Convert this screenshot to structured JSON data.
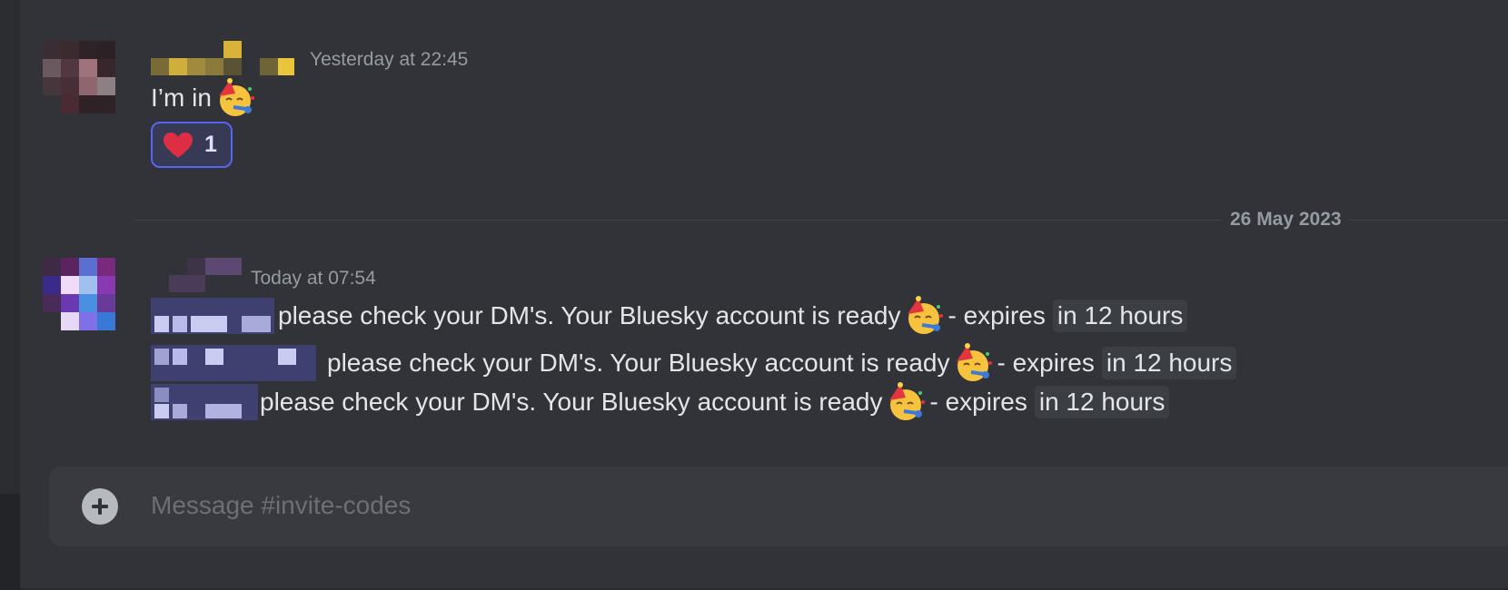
{
  "colors": {
    "background": "#313338",
    "accent": "#5865f2",
    "muted_text": "#949ba4",
    "message_text": "#e3e5e8"
  },
  "messages": [
    {
      "author_censored": true,
      "timestamp": "Yesterday at 22:45",
      "text": "I’m in",
      "emoji": "partying-face-icon",
      "reaction": {
        "emoji": "heart-icon",
        "count": "1"
      }
    }
  ],
  "date_divider": "26 May 2023",
  "message2": {
    "author_censored": true,
    "timestamp": "Today at 07:54",
    "lines": [
      {
        "mention_censored": true,
        "text": "please check your DM's. Your Bluesky account is ready",
        "emoji": "partying-face-icon",
        "suffix": "- expires",
        "code": "in 12 hours"
      },
      {
        "mention_censored": true,
        "text": "please check your DM's. Your Bluesky account is ready",
        "emoji": "partying-face-icon",
        "suffix": "- expires",
        "code": "in 12 hours"
      },
      {
        "mention_censored": true,
        "text": "please check your DM's. Your Bluesky account is ready",
        "emoji": "partying-face-icon",
        "suffix": "- expires",
        "code": "in 12 hours"
      }
    ]
  },
  "composer": {
    "placeholder": "Message #invite-codes"
  }
}
